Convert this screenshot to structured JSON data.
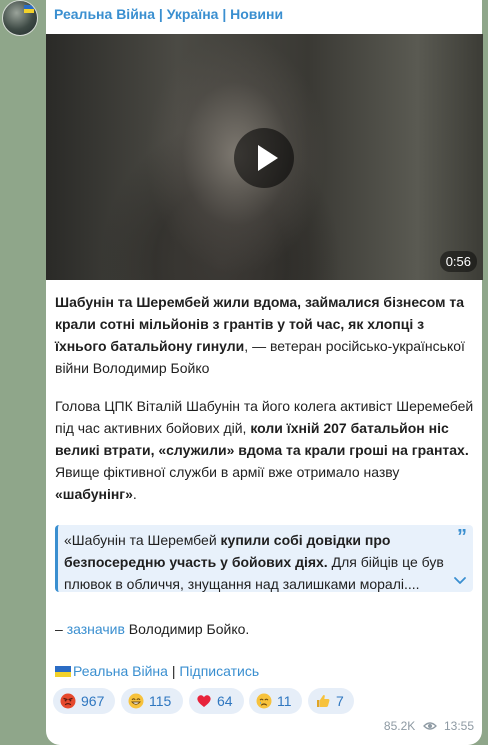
{
  "channel": {
    "title": "Реальна Війна | Україна | Новини"
  },
  "video": {
    "duration": "0:56"
  },
  "post": {
    "p1": {
      "bold": "Шабунін та Шерембей жили вдома, займалися бізнесом та крали сотні мільйонів з грантів у той час, як хлопці з їхнього батальйону гинули",
      "rest": ", — ветеран російсько-української війни Володимир Бойко"
    },
    "p2": {
      "t1": "Голова ЦПК Віталій Шабунін та його колега активіст Шеремебей під час активних бойових дій, ",
      "b1": "коли їхній 207 батальйон ніс великі втрати, «служили» вдома та крали гроші на грантах.",
      "t2": " Явище фіктивної служби в армії вже отримало назву ",
      "b2": "«шабунінг»",
      "t3": "."
    },
    "quote": {
      "t1": "«Шабунін та Шерембей ",
      "b1": "купили собі довідки про безпосередню участь у бойових діях.",
      "t2": " Для бійців це був плювок в обличчя, знущання над залишками моралі...."
    },
    "p3": {
      "dash": "– ",
      "link": "зазначив",
      "rest": " Володимир Бойко."
    }
  },
  "footer": {
    "channel_link": "Реальна Війна",
    "separator": " | ",
    "subscribe": "Підписатись"
  },
  "reactions": [
    {
      "emoji": "angry-face",
      "count": "967",
      "color": "#e6492d"
    },
    {
      "emoji": "grinning-face",
      "count": "115",
      "color": "#f7c23c"
    },
    {
      "emoji": "red-heart",
      "count": "64",
      "color": "#e8233b"
    },
    {
      "emoji": "crying-face",
      "count": "11",
      "color": "#f7c23c"
    },
    {
      "emoji": "thumbs-up",
      "count": "7",
      "color": "#f7c23c"
    }
  ],
  "meta": {
    "views": "85.2K",
    "time": "13:55"
  }
}
